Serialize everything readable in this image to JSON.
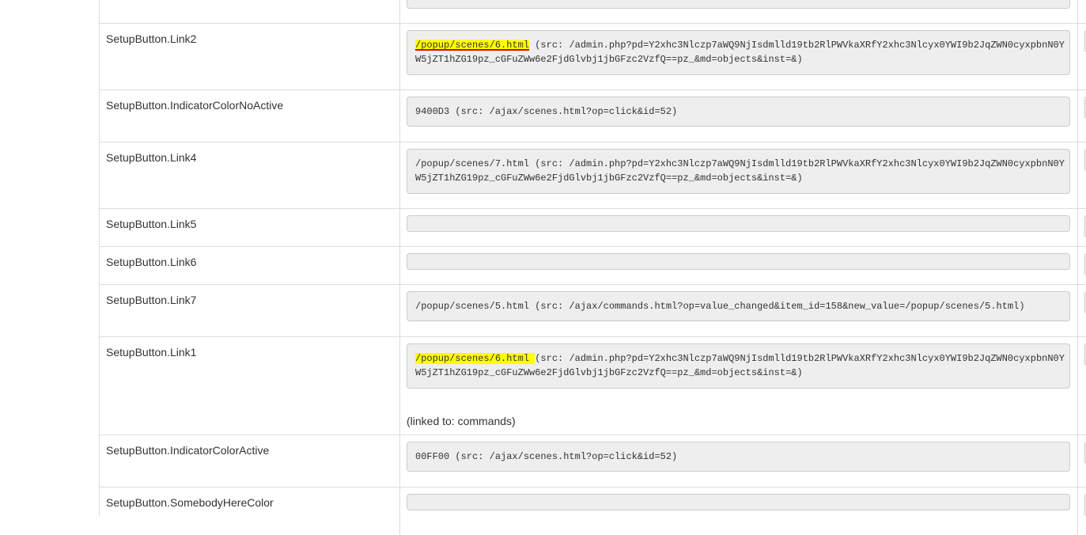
{
  "rows": [
    {
      "name": "",
      "line1": "",
      "line2": ""
    },
    {
      "name": "SetupButton.Link2",
      "link": "/popup/scenes/6.html",
      "line1_rest": " (src: /admin.php?pd=Y2xhc3Nlczp7aWQ9NjIsdmlld19tb2RlPWVkaXRfY2xhc3Nlcyx0YWI9b2JqZWN0cyxpbnN0Y",
      "line2": "W5jZT1hZG19pz_cGFuZWw6e2FjdGlvbj1jbGFzc2VzfQ==pz_&md=objects&inst=&)"
    },
    {
      "name": "SetupButton.IndicatorColorNoActive",
      "line1": "9400D3 (src: /ajax/scenes.html?op=click&id=52)"
    },
    {
      "name": "SetupButton.Link4",
      "line1": "/popup/scenes/7.html (src: /admin.php?pd=Y2xhc3Nlczp7aWQ9NjIsdmlld19tb2RlPWVkaXRfY2xhc3Nlcyx0YWI9b2JqZWN0cyxpbnN0Y",
      "line2": "W5jZT1hZG19pz_cGFuZWw6e2FjdGlvbj1jbGFzc2VzfQ==pz_&md=objects&inst=&)"
    },
    {
      "name": "SetupButton.Link5",
      "line1": ""
    },
    {
      "name": "SetupButton.Link6",
      "line1": ""
    },
    {
      "name": "SetupButton.Link7",
      "line1": "/popup/scenes/5.html (src: /ajax/commands.html?op=value_changed&item_id=158&new_value=/popup/scenes/5.html)"
    },
    {
      "name": "SetupButton.Link1",
      "link": "/popup/scenes/6.html ",
      "line1_rest": "(src: /admin.php?pd=Y2xhc3Nlczp7aWQ9NjIsdmlld19tb2RlPWVkaXRfY2xhc3Nlcyx0YWI9b2JqZWN0cyxpbnN0Y",
      "line2": "W5jZT1hZG19pz_cGFuZWw6e2FjdGlvbj1jbGFzc2VzfQ==pz_&md=objects&inst=&)",
      "linked_to": "(linked to: commands)"
    },
    {
      "name": "SetupButton.IndicatorColorActive",
      "line1": "00FF00 (src: /ajax/scenes.html?op=click&id=52)"
    },
    {
      "name": "SetupButton.SomebodyHereColor",
      "line1": ""
    }
  ],
  "colors": {
    "highlight": "#ffff00",
    "underline": "#e00000",
    "border": "#dddddd",
    "field_bg": "#eeeeee"
  }
}
